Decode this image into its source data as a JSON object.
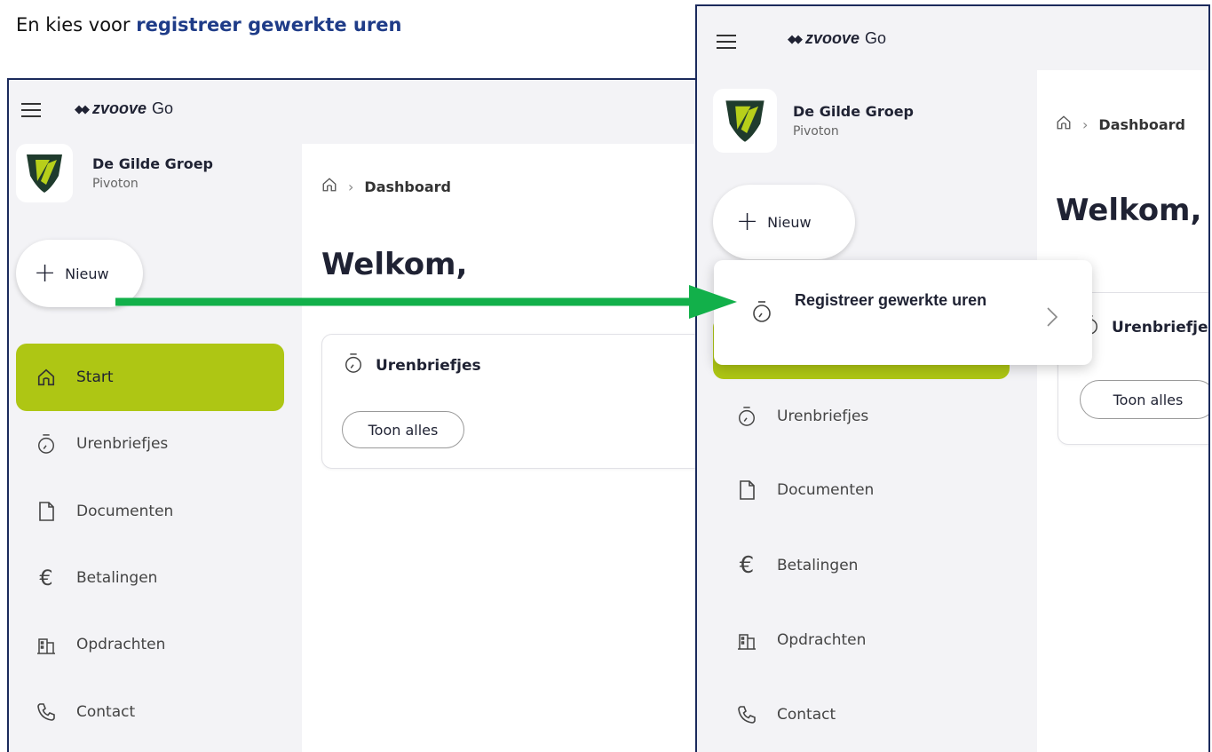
{
  "caption": {
    "prefix": "En kies voor ",
    "highlight": "registreer gewerkte uren"
  },
  "app": {
    "brand": "zvoove",
    "product": "Go"
  },
  "org": {
    "name": "De Gilde Groep",
    "sub": "Pivoton"
  },
  "new_button": {
    "label": "Nieuw"
  },
  "nav": [
    {
      "label": "Start",
      "icon": "home-icon"
    },
    {
      "label": "Urenbriefjes",
      "icon": "stopwatch-icon"
    },
    {
      "label": "Documenten",
      "icon": "document-icon"
    },
    {
      "label": "Betalingen",
      "icon": "euro-icon"
    },
    {
      "label": "Opdrachten",
      "icon": "building-icon"
    },
    {
      "label": "Contact",
      "icon": "phone-icon"
    }
  ],
  "breadcrumb": {
    "current": "Dashboard"
  },
  "welcome": "Welkom,",
  "card": {
    "title": "Urenbriefjes",
    "button": "Toon alles"
  },
  "dropdown": {
    "item": "Registreer gewerkte uren"
  },
  "colors": {
    "accent": "#aec614",
    "arrow": "#12b04a",
    "frame": "#1b2a5c",
    "caption_highlight": "#1f3c88"
  }
}
